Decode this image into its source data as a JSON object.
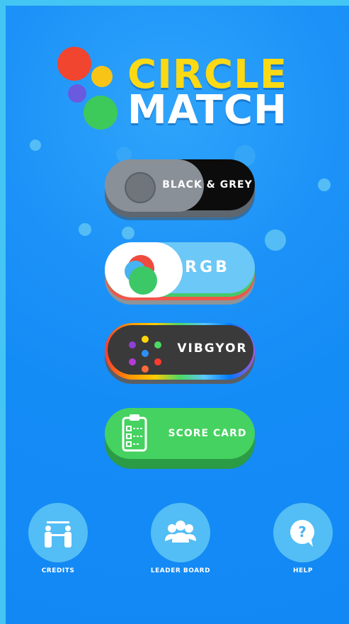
{
  "title": {
    "line1": "CIRCLE",
    "line2": "MATCH"
  },
  "modes": [
    {
      "label": "BLACK & GREY"
    },
    {
      "label": "RGB"
    },
    {
      "label": "VIBGYOR"
    },
    {
      "label": "SCORE CARD"
    }
  ],
  "footer": [
    {
      "label": "CREDITS",
      "icon": "credits-icon"
    },
    {
      "label": "LEADER BOARD",
      "icon": "leaderboard-icon"
    },
    {
      "label": "HELP",
      "icon": "help-icon"
    }
  ],
  "colors": {
    "background": "#148cf6",
    "title_yellow": "#fbd915",
    "logo_red": "#f1452f",
    "logo_yellow": "#f8c516",
    "logo_purple": "#6a5adf",
    "logo_green": "#3ec95b"
  }
}
